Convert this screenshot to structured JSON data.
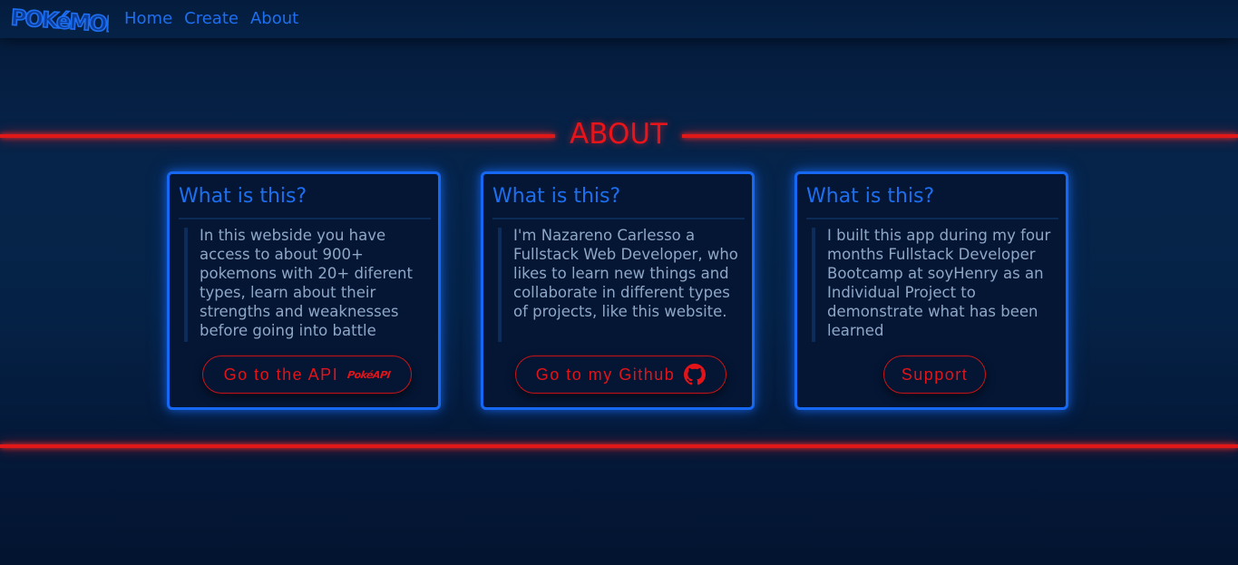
{
  "nav": {
    "logo_text": "POKéMON",
    "links": [
      {
        "label": "Home"
      },
      {
        "label": "Create"
      },
      {
        "label": "About"
      }
    ]
  },
  "page": {
    "title": "ABOUT"
  },
  "cards": [
    {
      "title": "What is this?",
      "text": "In this webside you have access to about 900+ pokemons with 20+ diferent types, learn about their strengths and weaknesses before going into battle",
      "button_label": "Go to the API",
      "button_icon": "pokeapi-logo-icon",
      "button_icon_text": "PokéAPI"
    },
    {
      "title": "What is this?",
      "text": "I'm Nazareno Carlesso a Fullstack Web Developer, who likes to learn new things and collaborate in different types of projects, like this website.",
      "button_label": "Go to my Github",
      "button_icon": "github-icon"
    },
    {
      "title": "What is this?",
      "text": "I built this app during my four months Fullstack Developer Bootcamp at soyHenry as an Individual Project to demonstrate what has been learned",
      "button_label": "Support"
    }
  ],
  "colors": {
    "background": "#052246",
    "accent_blue": "#1668f2",
    "accent_red": "#e01818",
    "text_muted": "#8fa7c6"
  }
}
